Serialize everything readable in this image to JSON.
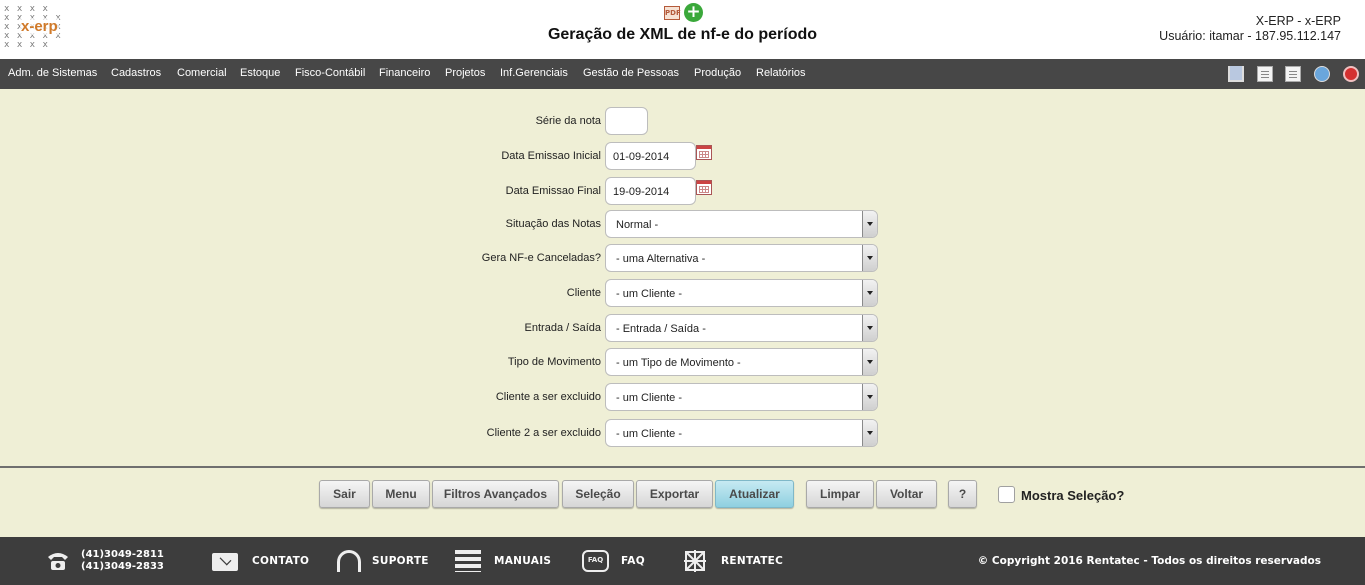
{
  "header": {
    "logo_text": "x-erp",
    "title": "Geração de XML de nf-e do período",
    "user_line1": "X-ERP - x-ERP",
    "user_line2": "Usuário: itamar - 187.95.112.147"
  },
  "nav": {
    "items": [
      "Adm. de Sistemas",
      "Cadastros",
      "Comercial",
      "Estoque",
      "Fisco-Contábil",
      "Financeiro",
      "Projetos",
      "Inf.Gerenciais",
      "Gestão de Pessoas",
      "Produção",
      "Relatórios"
    ]
  },
  "form": {
    "serie": {
      "label": "Série da nota",
      "value": ""
    },
    "data_inicial": {
      "label": "Data Emissao Inicial",
      "value": "01-09-2014"
    },
    "data_final": {
      "label": "Data Emissao Final",
      "value": "19-09-2014"
    },
    "situacao": {
      "label": "Situação das Notas",
      "value": "Normal -"
    },
    "canceladas": {
      "label": "Gera NF-e Canceladas?",
      "value": "- uma Alternativa -"
    },
    "cliente": {
      "label": "Cliente",
      "value": "- um Cliente -"
    },
    "entrada_saida": {
      "label": "Entrada / Saída",
      "value": "- Entrada / Saída -"
    },
    "tipo_movimento": {
      "label": "Tipo de Movimento",
      "value": "- um Tipo de Movimento -"
    },
    "cliente_excluido": {
      "label": "Cliente a ser excluido",
      "value": "- um Cliente -"
    },
    "cliente2_excluido": {
      "label": "Cliente 2 a ser excluido",
      "value": "- um Cliente -"
    }
  },
  "buttons": {
    "sair": "Sair",
    "menu": "Menu",
    "filtros": "Filtros Avançados",
    "selecao": "Seleção",
    "exportar": "Exportar",
    "atualizar": "Atualizar",
    "limpar": "Limpar",
    "voltar": "Voltar",
    "help": "?",
    "mostra_selecao": "Mostra Seleção?"
  },
  "footer": {
    "phone1": "(41)3049-2811",
    "phone2": "(41)3049-2833",
    "contato": "CONTATO",
    "suporte": "SUPORTE",
    "manuais": "MANUAIS",
    "faq": "FAQ",
    "rentatec": "RENTATEC",
    "copyright": "© Copyright 2016 Rentatec - Todos os direitos reservados"
  },
  "colors": {
    "background": "#efefd6",
    "navbar": "#474747",
    "footer": "#3d3d3d",
    "primary_button": "#8fd0e0"
  },
  "icons": [
    "pdf-icon",
    "add-icon",
    "home-icon",
    "document-icon",
    "list-icon",
    "globe-icon",
    "power-icon",
    "calendar-icon",
    "phone-icon",
    "mail-icon",
    "headset-icon",
    "books-icon",
    "faq-icon",
    "rentatec-icon"
  ]
}
